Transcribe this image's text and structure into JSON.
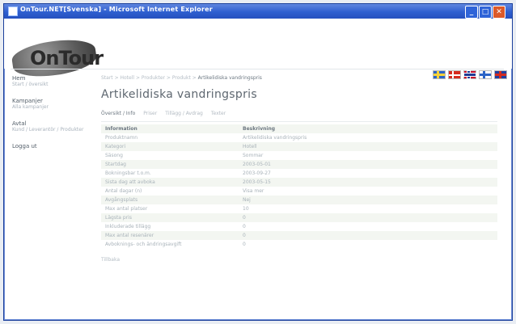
{
  "window": {
    "title": "OnTour.NET[Svenska] - Microsoft Internet Explorer"
  },
  "brand": {
    "logo_text": "OnTour"
  },
  "languages": [
    "Svenska",
    "Dansk",
    "Norsk",
    "Suomi",
    "English"
  ],
  "sidebar": {
    "groups": [
      {
        "title": "Hem",
        "sub": "Start / översikt"
      },
      {
        "title": "Kampanjer",
        "sub": "Alla kampanjer"
      },
      {
        "title": "Avtal",
        "sub": "Kund / Leverantör / Produkter"
      },
      {
        "title": "Logga ut",
        "sub": ""
      }
    ]
  },
  "breadcrumb": {
    "path": "Start > Hotell > Produkter > Produkt >",
    "current": "Artikelidiska vandringspris"
  },
  "page": {
    "title": "Artikelidiska vandringspris"
  },
  "tabs": [
    {
      "label": "Översikt / Info"
    },
    {
      "label": "Priser"
    },
    {
      "label": "Tillägg / Avdrag"
    },
    {
      "label": "Texter"
    }
  ],
  "table": {
    "headers": [
      "Information",
      "Beskrivning"
    ],
    "rows": [
      [
        "Produktnamn",
        "Artikelidiska vandringspris"
      ],
      [
        "Kategori",
        "Hotell"
      ],
      [
        "Säsong",
        "Sommar"
      ],
      [
        "Startdag",
        "2003-05-01"
      ],
      [
        "Bokningsbar t.o.m.",
        "2003-09-27"
      ],
      [
        "Sista dag att avboka",
        "2003-05-15"
      ],
      [
        "Antal dagar (n)",
        "Visa mer"
      ],
      [
        "Avgångsplats",
        "Nej"
      ],
      [
        "Max antal platser",
        "10"
      ],
      [
        "Lägsta pris",
        "0"
      ],
      [
        "Inkluderade tillägg",
        "0"
      ],
      [
        "Max antal resenärer",
        "0"
      ],
      [
        "Avboknings- och ändringsavgift",
        "0"
      ]
    ]
  },
  "footer": {
    "back_link": "Tillbaka"
  }
}
